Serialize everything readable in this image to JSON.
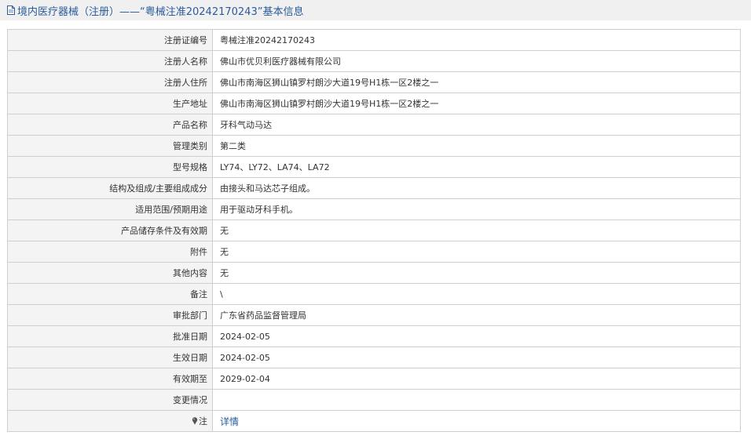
{
  "title": "境内医疗器械（注册）——“粤械注准20242170243”基本信息",
  "rows": [
    {
      "label": "注册证编号",
      "value": "粤械注准20242170243"
    },
    {
      "label": "注册人名称",
      "value": "佛山市优贝利医疗器械有限公司"
    },
    {
      "label": "注册人住所",
      "value": "佛山市南海区狮山镇罗村朗沙大道19号H1栋一区2楼之一"
    },
    {
      "label": "生产地址",
      "value": "佛山市南海区狮山镇罗村朗沙大道19号H1栋一区2楼之一"
    },
    {
      "label": "产品名称",
      "value": "牙科气动马达"
    },
    {
      "label": "管理类别",
      "value": "第二类"
    },
    {
      "label": "型号规格",
      "value": "LY74、LY72、LA74、LA72"
    },
    {
      "label": "结构及组成/主要组成成分",
      "value": "由接头和马达芯子组成。"
    },
    {
      "label": "适用范围/预期用途",
      "value": "用于驱动牙科手机。"
    },
    {
      "label": "产品储存条件及有效期",
      "value": "无"
    },
    {
      "label": "附件",
      "value": "无"
    },
    {
      "label": "其他内容",
      "value": "无"
    },
    {
      "label": "备注",
      "value": "\\"
    },
    {
      "label": "审批部门",
      "value": "广东省药品监督管理局"
    },
    {
      "label": "批准日期",
      "value": "2024-02-05"
    },
    {
      "label": "生效日期",
      "value": "2024-02-05"
    },
    {
      "label": "有效期至",
      "value": "2029-02-04"
    },
    {
      "label": "变更情况",
      "value": ""
    }
  ],
  "note": {
    "label": "注",
    "link_text": "详情"
  },
  "colors": {
    "title_text": "#2a5b9d",
    "label_bg": "#f4f4f4",
    "border": "#cfcfcf",
    "link": "#2a5b9d"
  }
}
